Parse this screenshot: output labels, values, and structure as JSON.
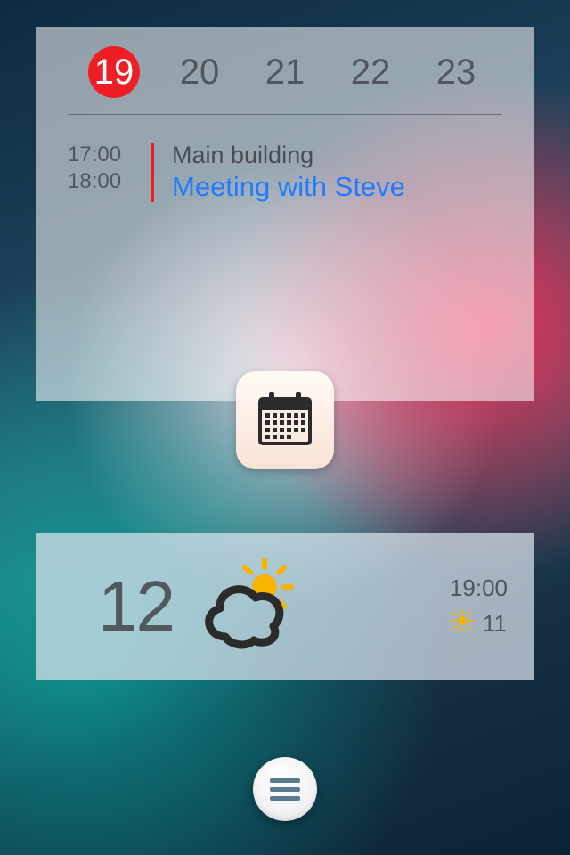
{
  "calendar": {
    "days": [
      "19",
      "20",
      "21",
      "22",
      "23"
    ],
    "selected_index": 0,
    "event": {
      "start": "17:00",
      "end": "18:00",
      "location": "Main building",
      "title": "Meeting with Steve"
    },
    "icon": "calendar-icon"
  },
  "weather": {
    "current_temp": "12",
    "current_icon": "partly-cloudy-icon",
    "forecast": {
      "time": "19:00",
      "icon": "sunny-icon",
      "temp": "11"
    }
  },
  "menu": {
    "icon": "menu-icon"
  },
  "colors": {
    "accent_red": "#ed1f24",
    "link_blue": "#1f7bff",
    "sun_yellow": "#f5b400"
  }
}
